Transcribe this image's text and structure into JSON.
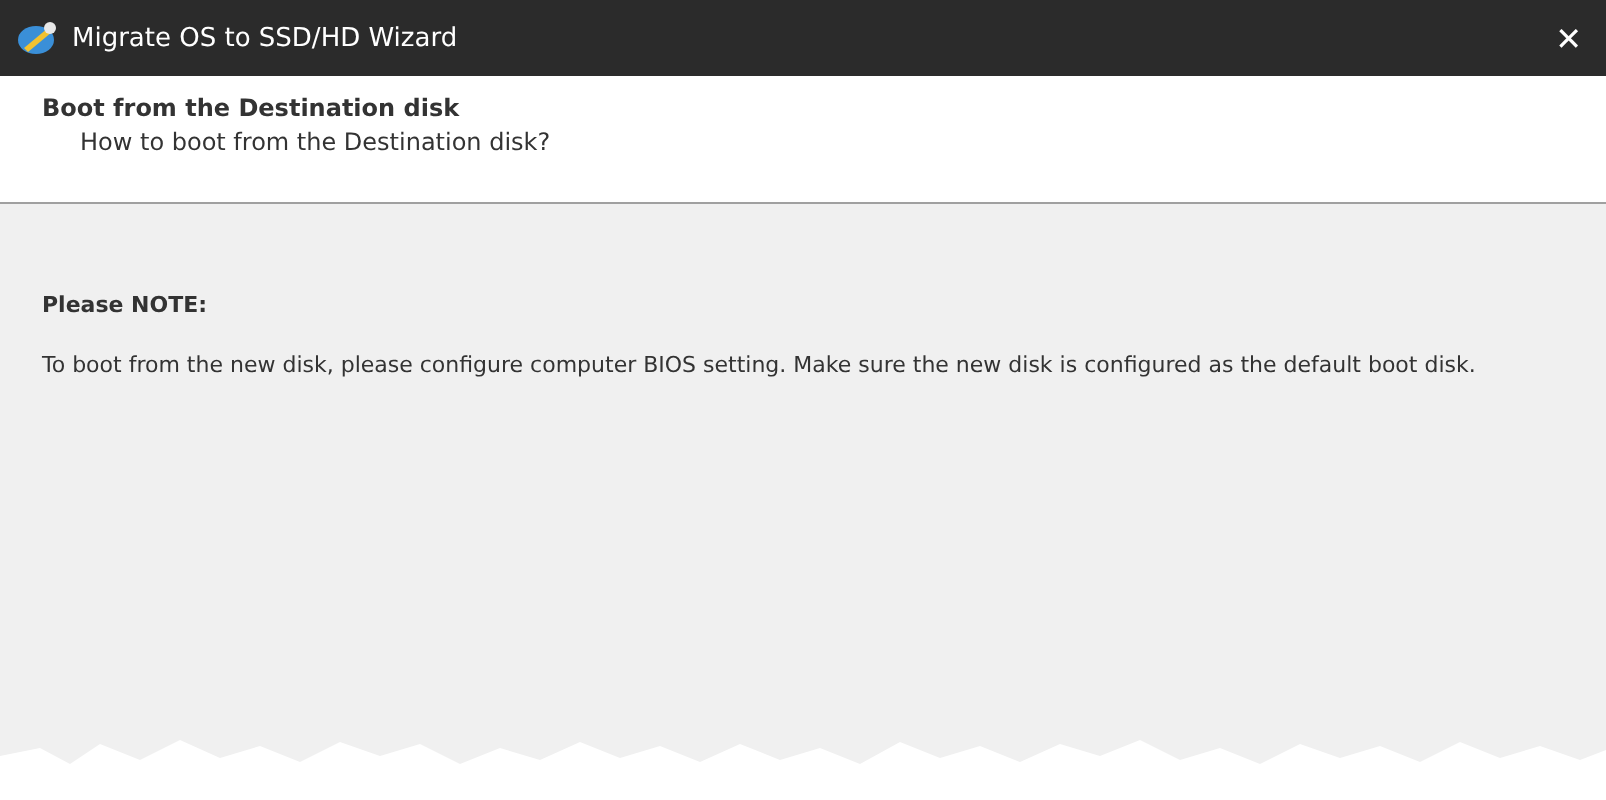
{
  "window": {
    "title": "Migrate OS to SSD/HD Wizard",
    "close": "✕"
  },
  "header": {
    "title": "Boot from the Destination disk",
    "subtitle": "How to boot from the Destination disk?"
  },
  "note": {
    "heading": "Please NOTE:",
    "text": "To boot from the new disk, please configure computer BIOS setting. Make sure the new disk is configured as the default boot disk."
  }
}
